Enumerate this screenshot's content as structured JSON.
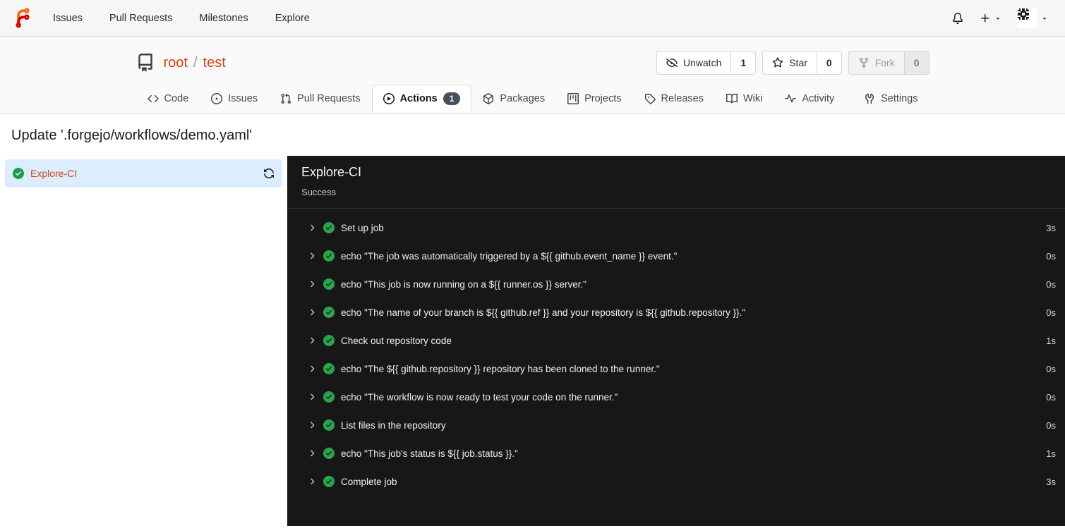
{
  "navbar": {
    "links": [
      {
        "label": "Issues"
      },
      {
        "label": "Pull Requests"
      },
      {
        "label": "Milestones"
      },
      {
        "label": "Explore"
      }
    ],
    "icons": {
      "logo": "forgejo-logo",
      "notifications": "bell-icon",
      "create_new": "plus-icon with caret-down",
      "user_menu": "identicon-avatar with caret-down"
    }
  },
  "repo": {
    "owner": "root",
    "separator": "/",
    "name": "test",
    "buttons": [
      {
        "label": "Unwatch",
        "count": "1",
        "icon": "eye-closed-icon"
      },
      {
        "label": "Star",
        "count": "0",
        "icon": "star-icon"
      },
      {
        "label": "Fork",
        "count": "0",
        "icon": "fork-icon",
        "disabled": true
      }
    ]
  },
  "tabs": [
    {
      "label": "Code",
      "icon": "code-icon"
    },
    {
      "label": "Issues",
      "icon": "issue-opened-icon"
    },
    {
      "label": "Pull Requests",
      "icon": "git-pull-request-icon"
    },
    {
      "label": "Actions",
      "icon": "play-icon",
      "badge": "1",
      "active": true
    },
    {
      "label": "Packages",
      "icon": "package-icon"
    },
    {
      "label": "Projects",
      "icon": "project-icon"
    },
    {
      "label": "Releases",
      "icon": "tag-icon"
    },
    {
      "label": "Wiki",
      "icon": "book-icon"
    },
    {
      "label": "Activity",
      "icon": "pulse-icon"
    },
    {
      "label": "Settings",
      "icon": "tools-icon"
    }
  ],
  "page": {
    "title": "Update '.forgejo/workflows/demo.yaml'"
  },
  "sidebar": {
    "jobs": [
      {
        "name": "Explore-CI",
        "status": "success",
        "active": true
      }
    ]
  },
  "job_panel": {
    "title": "Explore-CI",
    "status": "Success",
    "steps": [
      {
        "name": "Set up job",
        "duration": "3s"
      },
      {
        "name": "echo \"The job was automatically triggered by a ${{ github.event_name }} event.\"",
        "duration": "0s"
      },
      {
        "name": "echo \"This job is now running on a ${{ runner.os }} server.\"",
        "duration": "0s"
      },
      {
        "name": "echo \"The name of your branch is ${{ github.ref }} and your repository is ${{ github.repository }}.\"",
        "duration": "0s"
      },
      {
        "name": "Check out repository code",
        "duration": "1s"
      },
      {
        "name": "echo \"The ${{ github.repository }} repository has been cloned to the runner.\"",
        "duration": "0s"
      },
      {
        "name": "echo \"The workflow is now ready to test your code on the runner.\"",
        "duration": "0s"
      },
      {
        "name": "List files in the repository",
        "duration": "0s"
      },
      {
        "name": "echo \"This job's status is ${{ job.status }}.\"",
        "duration": "1s"
      },
      {
        "name": "Complete job",
        "duration": "3s"
      }
    ]
  },
  "colors": {
    "primary_link": "#cf4217",
    "success_green": "#1e9e4b",
    "panel_background": "#171717",
    "sidebar_active_background": "#dcedff",
    "badge_background": "#45505f",
    "navbar_background": "#f6f6f7",
    "header_background": "#fafafa"
  }
}
